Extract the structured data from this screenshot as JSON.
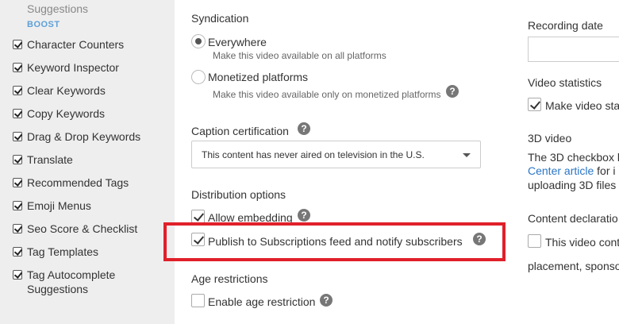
{
  "sidebar": {
    "top_label": "Suggestions",
    "boost_label": "BOOST",
    "items": [
      {
        "label": "Character Counters"
      },
      {
        "label": "Keyword Inspector"
      },
      {
        "label": "Clear Keywords"
      },
      {
        "label": "Copy Keywords"
      },
      {
        "label": "Drag & Drop Keywords"
      },
      {
        "label": "Translate"
      },
      {
        "label": "Recommended Tags"
      },
      {
        "label": "Emoji Menus"
      },
      {
        "label": "Seo Score & Checklist"
      },
      {
        "label": "Tag Templates"
      },
      {
        "label": "Tag Autocomplete Suggestions"
      }
    ]
  },
  "syndication": {
    "title": "Syndication",
    "everywhere_label": "Everywhere",
    "everywhere_desc": "Make this video available on all platforms",
    "monetized_label": "Monetized platforms",
    "monetized_desc": "Make this video available only on monetized platforms"
  },
  "caption": {
    "title": "Caption certification",
    "selected": "This content has never aired on television in the U.S."
  },
  "distribution": {
    "title": "Distribution options",
    "allow_embedding": "Allow embedding",
    "publish_feed": "Publish to Subscriptions feed and notify subscribers"
  },
  "age": {
    "title": "Age restrictions",
    "enable_label": "Enable age restriction"
  },
  "right": {
    "recording_date_title": "Recording date",
    "video_stats_title": "Video statistics",
    "video_stats_label": "Make video sta",
    "video_3d_title": "3D video",
    "video_3d_line1": "The 3D checkbox l",
    "video_3d_link": "Center article",
    "video_3d_line2_rest": " for i",
    "video_3d_line3": "uploading 3D files",
    "content_decl_title": "Content declaratio",
    "content_decl_label": "This video cont",
    "content_decl_line2": "placement, sponso"
  },
  "help_glyph": "?"
}
